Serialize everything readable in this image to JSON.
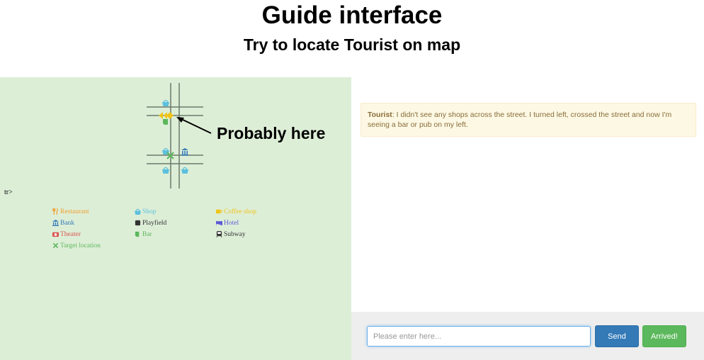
{
  "header": {
    "title": "Guide interface",
    "subtitle": "Try to locate Tourist on map"
  },
  "map": {
    "annotation": "Probably here",
    "stray_text": "tr>",
    "legend": [
      {
        "label": "Restaurant",
        "icon": "utensils-icon",
        "color": "#f0a030"
      },
      {
        "label": "Shop",
        "icon": "basket-icon",
        "color": "#5bc0de"
      },
      {
        "label": "Coffee shop",
        "icon": "coffee-icon",
        "color": "#f0c419"
      },
      {
        "label": "Bank",
        "icon": "bank-icon",
        "color": "#337ab7"
      },
      {
        "label": "Playfield",
        "icon": "square-icon",
        "color": "#333333"
      },
      {
        "label": "Hotel",
        "icon": "bed-icon",
        "color": "#5b5bd6"
      },
      {
        "label": "Theater",
        "icon": "camera-icon",
        "color": "#d9534f"
      },
      {
        "label": "Bar",
        "icon": "beer-icon",
        "color": "#5cb85c"
      },
      {
        "label": "Subway",
        "icon": "subway-icon",
        "color": "#333333"
      },
      {
        "label": "Target location",
        "icon": "x-icon",
        "color": "#5cb85c"
      }
    ]
  },
  "chat": {
    "message_sender": "Tourist",
    "message_text": ": I didn't see any shops across the street. I turned left, crossed the street and now I'm seeing a bar or pub on my left."
  },
  "input": {
    "placeholder": "Please enter here...",
    "send_label": "Send",
    "arrived_label": "Arrived!"
  },
  "colors": {
    "map_background": "#ddeed7",
    "message_background": "#fcf8e3",
    "message_text": "#8a6d3b",
    "send_button": "#337ab7",
    "arrived_button": "#5cb85c"
  }
}
